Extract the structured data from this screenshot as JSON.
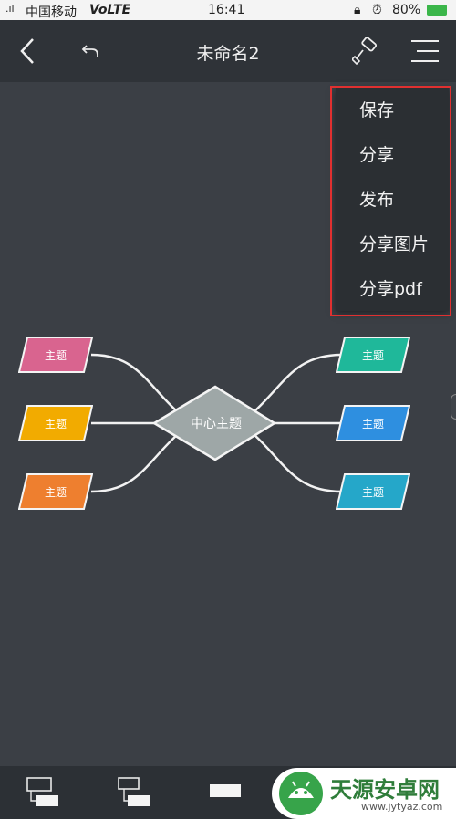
{
  "status_bar": {
    "carrier": "中国移动",
    "network": "VoLTE",
    "time": "16:41",
    "battery": "80%"
  },
  "toolbar": {
    "title": "未命名2",
    "back_icon": "chevron-left-icon",
    "undo_icon": "undo-icon",
    "style_icon": "paint-roller-icon",
    "menu_icon": "hamburger-menu-icon"
  },
  "menu": {
    "items": [
      "保存",
      "分享",
      "发布",
      "分享图片",
      "分享pdf"
    ]
  },
  "mindmap": {
    "center": "中心主题",
    "left_topics": [
      {
        "label": "主题",
        "color": "#d9648f"
      },
      {
        "label": "主题",
        "color": "#f2ab00"
      },
      {
        "label": "主题",
        "color": "#ee7f2f"
      }
    ],
    "right_topics": [
      {
        "label": "主题",
        "color": "#1fb89a"
      },
      {
        "label": "主题",
        "color": "#2e8fe0"
      },
      {
        "label": "主题",
        "color": "#25a7c9"
      }
    ],
    "center_color": "#9ea7a7"
  },
  "watermark": {
    "name": "天源安卓网",
    "url": "www.jytyaz.com"
  }
}
